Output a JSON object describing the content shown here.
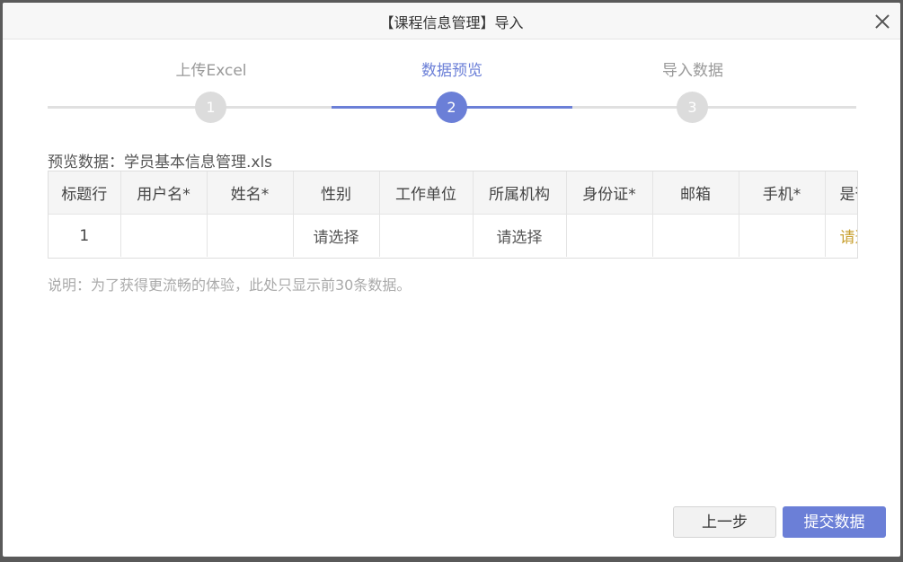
{
  "dialog": {
    "title": "【课程信息管理】导入",
    "close_icon": "close-icon"
  },
  "steps": [
    {
      "label": "上传Excel",
      "number": "1",
      "state": "done"
    },
    {
      "label": "数据预览",
      "number": "2",
      "state": "active"
    },
    {
      "label": "导入数据",
      "number": "3",
      "state": "pending"
    }
  ],
  "preview": {
    "label": "预览数据：学员基本信息管理.xls"
  },
  "table": {
    "headers": [
      "标题行",
      "用户名*",
      "姓名*",
      "性别",
      "工作单位",
      "所属机构",
      "身份证*",
      "邮箱",
      "手机*",
      "是否"
    ],
    "rows": [
      [
        "1",
        "",
        "",
        "请选择",
        "",
        "请选择",
        "",
        "",
        "",
        "请选择"
      ]
    ]
  },
  "note": "说明：为了获得更流畅的体验，此处只显示前30条数据。",
  "buttons": {
    "prev": "上一步",
    "submit": "提交数据"
  },
  "colors": {
    "accent": "#6b7fd7",
    "inactive": "#dcdcdc"
  }
}
